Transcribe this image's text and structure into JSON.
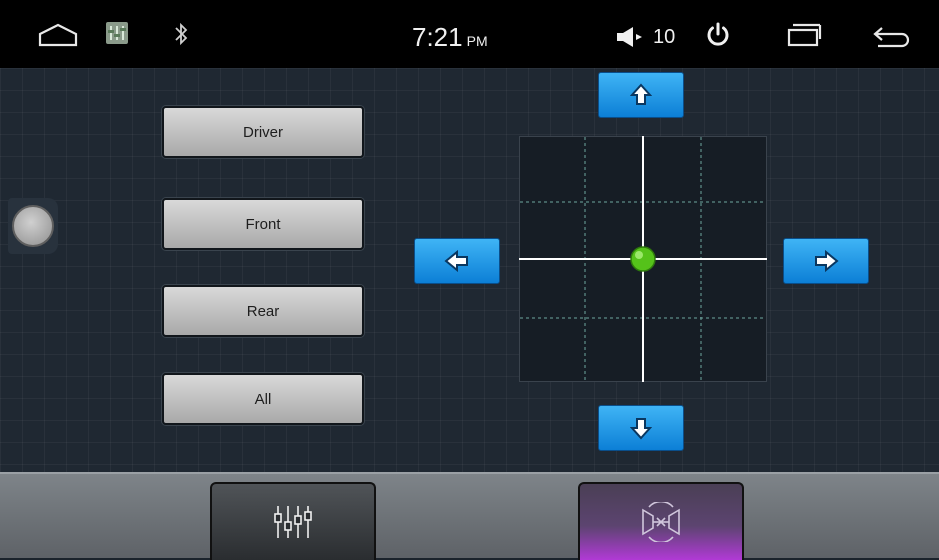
{
  "status_bar": {
    "time": "7:21",
    "ampm": "PM",
    "volume": "10",
    "icons": {
      "home": "home-icon",
      "equalizer_app": "equalizer-app-icon",
      "bluetooth": "bluetooth-icon",
      "volume": "volume-icon",
      "power": "power-icon",
      "recent": "recent-apps-icon",
      "back": "back-icon"
    }
  },
  "zones": [
    {
      "label": "Driver"
    },
    {
      "label": "Front"
    },
    {
      "label": "Rear"
    },
    {
      "label": "All"
    }
  ],
  "balance_pad": {
    "balance": 0,
    "fader": 0,
    "dot_color": "#55c21a"
  },
  "colors": {
    "accent_blue": "#1a93e6",
    "active_tab_glow": "#b13ad6"
  },
  "bottom_tabs": [
    {
      "name": "equalizer",
      "icon": "equalizer-sliders-icon"
    },
    {
      "name": "balance-fader",
      "icon": "speaker-balance-icon",
      "active": true
    }
  ]
}
